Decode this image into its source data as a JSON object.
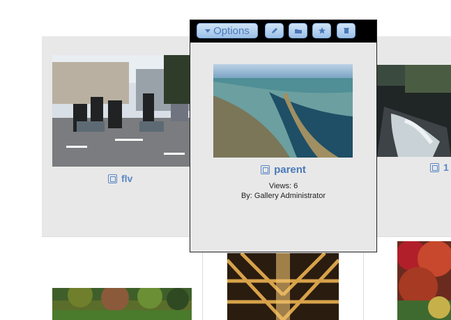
{
  "items": [
    {
      "title": "flv"
    },
    {
      "title": "1"
    }
  ],
  "popup": {
    "options_label": "Options",
    "actions": [
      {
        "icon": "edit-icon"
      },
      {
        "icon": "folder-icon"
      },
      {
        "icon": "star-icon"
      },
      {
        "icon": "trash-icon"
      }
    ],
    "title": "parent",
    "views": "Views: 6",
    "by": "By: Gallery Administrator"
  },
  "colors": {
    "link": "#5a86c4",
    "button_top": "#cfe3f7",
    "button_bottom": "#9cc0e8",
    "panel": "#e8e8e8",
    "toolbar": "#000000"
  }
}
